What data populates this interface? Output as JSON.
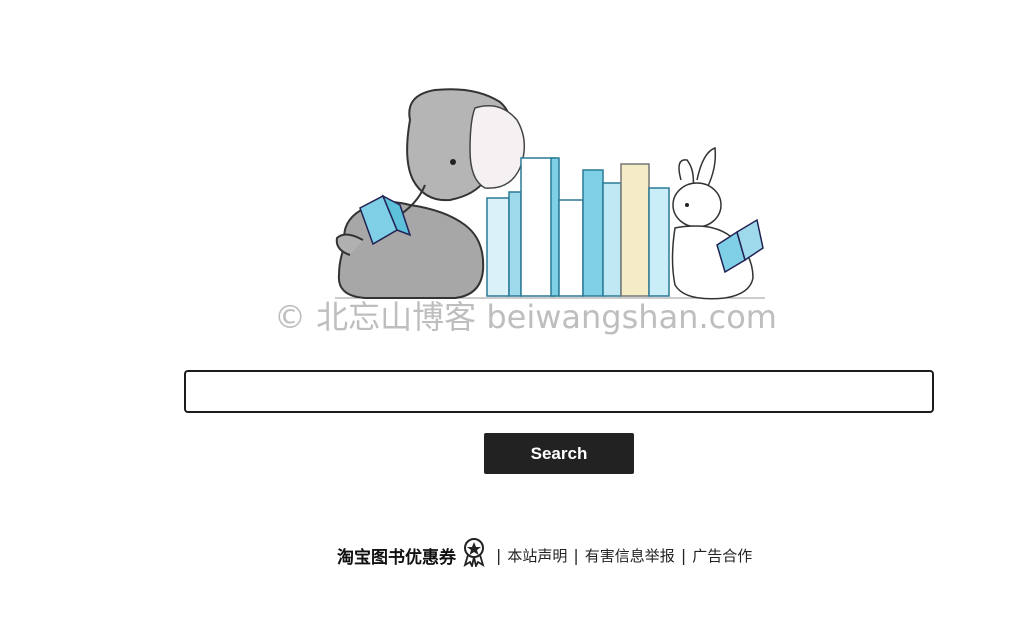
{
  "hero": {
    "watermark": "© 北忘山博客 beiwangshan.com"
  },
  "search": {
    "input_value": "",
    "placeholder": "",
    "button_label": "Search"
  },
  "footer": {
    "promo_label": "淘宝图书优惠券",
    "separator": "|",
    "links": [
      {
        "label": "本站声明"
      },
      {
        "label": "有害信息举报"
      },
      {
        "label": "广告合作"
      }
    ]
  },
  "colors": {
    "button_bg": "#222222",
    "button_text": "#ffffff",
    "input_border": "#1c1c1c",
    "book_blue": "#7fd0e6",
    "book_cream": "#f3ecc6"
  }
}
